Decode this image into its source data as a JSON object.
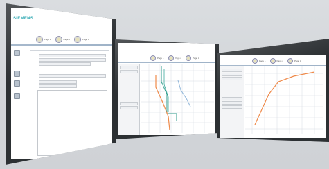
{
  "brand": {
    "logo_text": "SIEMENS"
  },
  "toolbar": {
    "items": [
      {
        "label": "Page 1",
        "icon": "tool-icon"
      },
      {
        "label": "Page 2",
        "icon": "tool-icon"
      },
      {
        "label": "Page 3",
        "icon": "tool-icon"
      }
    ]
  },
  "colors": {
    "background": "#d6d9dc",
    "accent": "#0b9aa6",
    "curve_orange": "#ef8a4a",
    "curve_teal": "#2c9a8a",
    "curve_blue": "#8fb5d9"
  }
}
